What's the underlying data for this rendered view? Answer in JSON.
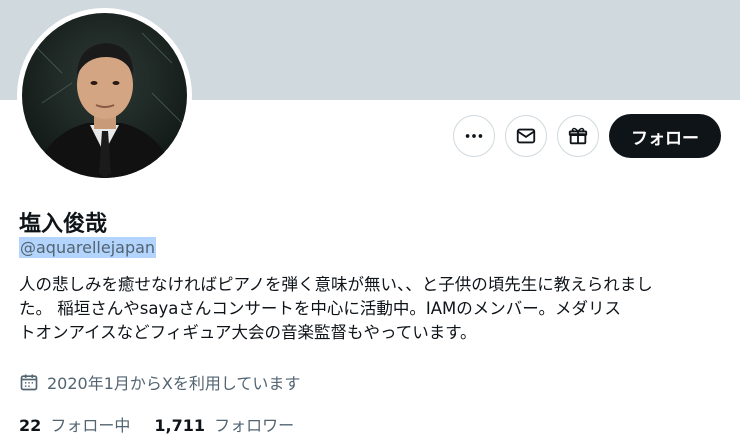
{
  "profile": {
    "name": "塩入俊哉",
    "handle": "@aquarellejapan",
    "bio": "人の悲しみを癒せなければピアノを弾く意味が無い、、と子供の頃先生に教えられまし\nた。 稲垣さんやsayaさんコンサートを中心に活動中。IAMのメンバー。メダリス\nトオンアイスなどフィギュア大会の音楽監督もやっています。",
    "joined": "2020年1月からXを利用しています"
  },
  "actions": {
    "follow_label": "フォロー"
  },
  "stats": {
    "following_count": "22",
    "following_label": "フォロー中",
    "followers_count": "1,711",
    "followers_label": "フォロワー"
  },
  "icons": {
    "more": "more-icon",
    "message": "mail-icon",
    "subscribe": "gift-icon",
    "calendar": "calendar-icon"
  }
}
